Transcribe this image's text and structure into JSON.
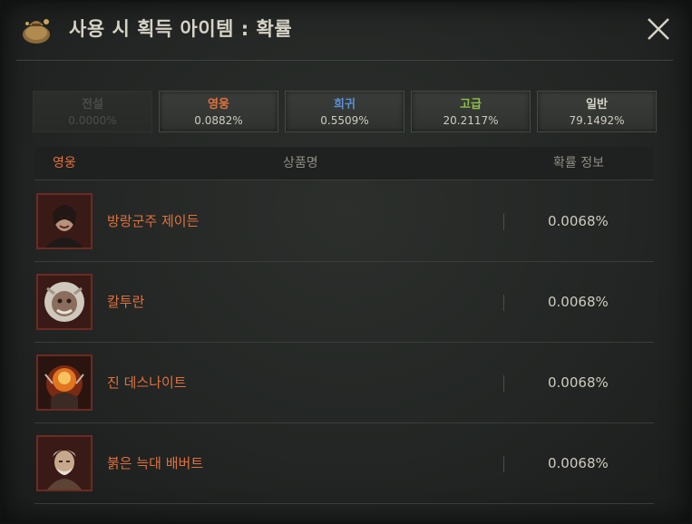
{
  "window": {
    "title": "사용 시 획득 아이템 : 확률",
    "icon": "treasure-sack-icon",
    "close_icon": "close-icon"
  },
  "tabs": [
    {
      "name": "전설",
      "pct": "0.0000%",
      "color": "#4a4d49",
      "enabled": false
    },
    {
      "name": "영웅",
      "pct": "0.0882%",
      "color": "#e0703f",
      "enabled": true
    },
    {
      "name": "희귀",
      "pct": "0.5509%",
      "color": "#5b8fd6",
      "enabled": true
    },
    {
      "name": "고급",
      "pct": "20.2117%",
      "color": "#8fbf4d",
      "enabled": true
    },
    {
      "name": "일반",
      "pct": "79.1492%",
      "color": "#d8d4c9",
      "enabled": true
    }
  ],
  "table": {
    "grade_header": "영웅",
    "name_header": "상품명",
    "prob_header": "확률 정보",
    "grade_color": "#e0703f",
    "rows": [
      {
        "name": "방랑군주 제이든",
        "prob": "0.0068%",
        "portrait": "jaden-portrait"
      },
      {
        "name": "칼투란",
        "prob": "0.0068%",
        "portrait": "kaltuan-portrait"
      },
      {
        "name": "진 데스나이트",
        "prob": "0.0068%",
        "portrait": "death-knight-portrait"
      },
      {
        "name": "붉은 늑대 배버트",
        "prob": "0.0068%",
        "portrait": "red-wolf-portrait"
      }
    ]
  }
}
